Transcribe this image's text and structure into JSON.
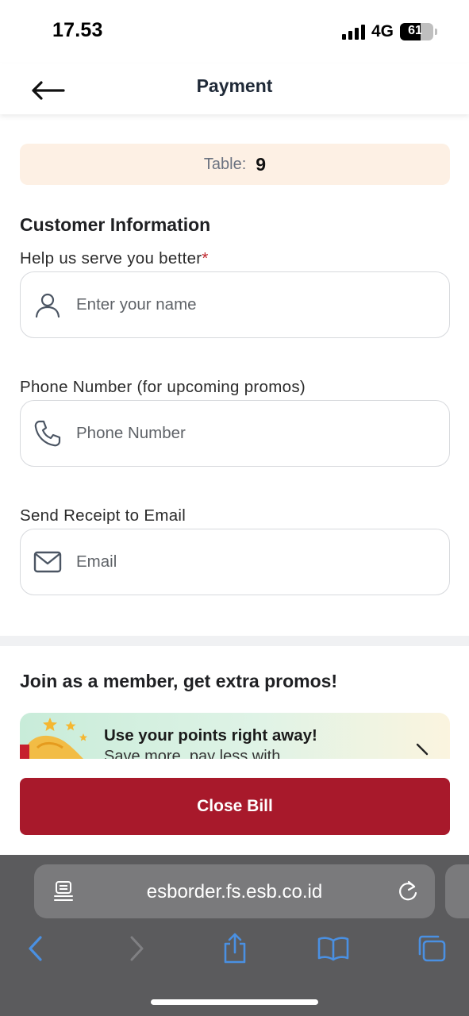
{
  "status_bar": {
    "time": "17.53",
    "network": "4G",
    "battery": "61",
    "battery_level_percent": 61
  },
  "header": {
    "title": "Payment",
    "back_icon": "arrow-left-icon"
  },
  "table": {
    "label": "Table:",
    "number": "9"
  },
  "customer_info": {
    "title": "Customer Information",
    "name_label": "Help us serve you better",
    "required_mark": "*",
    "name_placeholder": "Enter your name",
    "name_icon": "user-icon",
    "phone_label": "Phone Number (for upcoming promos)",
    "phone_placeholder": "Phone Number",
    "phone_icon": "phone-icon",
    "email_label": "Send Receipt to Email",
    "email_placeholder": "Email",
    "email_icon": "mail-icon"
  },
  "membership": {
    "title": "Join as a member, get extra promos!",
    "card_title": "Use your points right away!",
    "card_subtitle": "Save more, pay less with",
    "chevron_icon": "chevron-right-icon"
  },
  "actions": {
    "close_bill": "Close Bill"
  },
  "browser": {
    "url": "esborder.fs.esb.co.id",
    "page_icon": "page-menu-icon",
    "reload_icon": "reload-icon",
    "toolbar": [
      "back-icon",
      "forward-icon",
      "share-icon",
      "bookmarks-icon",
      "tabs-icon"
    ]
  },
  "colors": {
    "primary": "#a8192b",
    "table_banner_bg": "#fdf0e4",
    "required": "#c0262d",
    "browser_bg": "#5b5b5d",
    "browser_accent": "#4a90e2"
  }
}
